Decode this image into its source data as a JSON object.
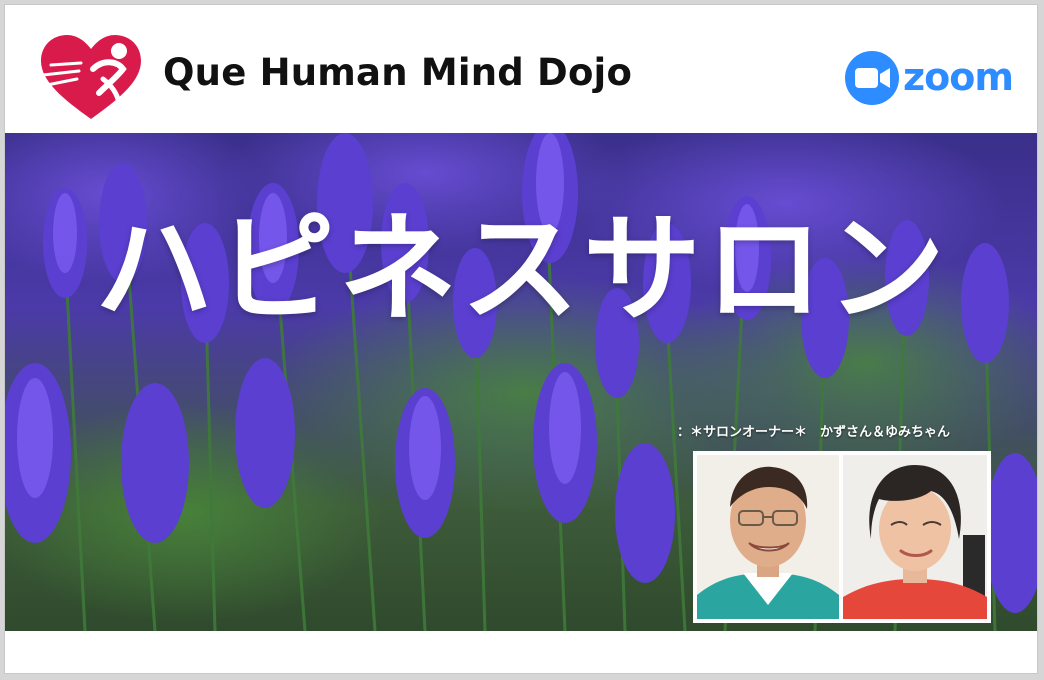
{
  "brand": {
    "name": "Que Human Mind Dojo",
    "logo_icon": "heart-figure-logo-icon",
    "logo_color": "#d81b4a"
  },
  "zoom": {
    "label": "zoom",
    "icon": "video-camera-icon",
    "color": "#2D8CFF"
  },
  "banner": {
    "title": "ハピネスサロン",
    "background": "lavender-field",
    "caption": "：＊サロンオーナー＊　かずさん＆ゆみちゃん"
  },
  "photos": [
    {
      "name": "owner-photo-kazu"
    },
    {
      "name": "owner-photo-yumi"
    }
  ]
}
